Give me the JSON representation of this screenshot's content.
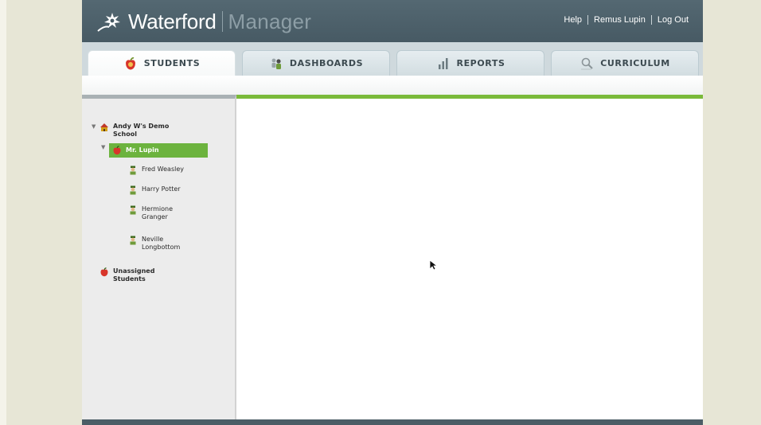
{
  "header": {
    "brand": "Waterford",
    "product": "Manager",
    "links": {
      "help": "Help",
      "user": "Remus Lupin",
      "logout": "Log Out"
    }
  },
  "tabs": [
    {
      "label": "STUDENTS",
      "icon": "apple-icon",
      "active": true
    },
    {
      "label": "DASHBOARDS",
      "icon": "people-icon",
      "active": false
    },
    {
      "label": "REPORTS",
      "icon": "bar-chart-icon",
      "active": false
    },
    {
      "label": "CURRICULUM",
      "icon": "magnifier-icon",
      "active": false
    }
  ],
  "tree": {
    "school": "Andy W's Demo School",
    "teacher": "Mr. Lupin",
    "students": [
      "Fred Weasley",
      "Harry Potter",
      "Hermione Granger",
      "Neville Longbottom"
    ],
    "unassigned": "Unassigned Students"
  },
  "colors": {
    "header": "#4e626b",
    "accent_green": "#6cb33e",
    "content_top_border": "#7aba3a",
    "page_background": "#e7e6d6"
  }
}
